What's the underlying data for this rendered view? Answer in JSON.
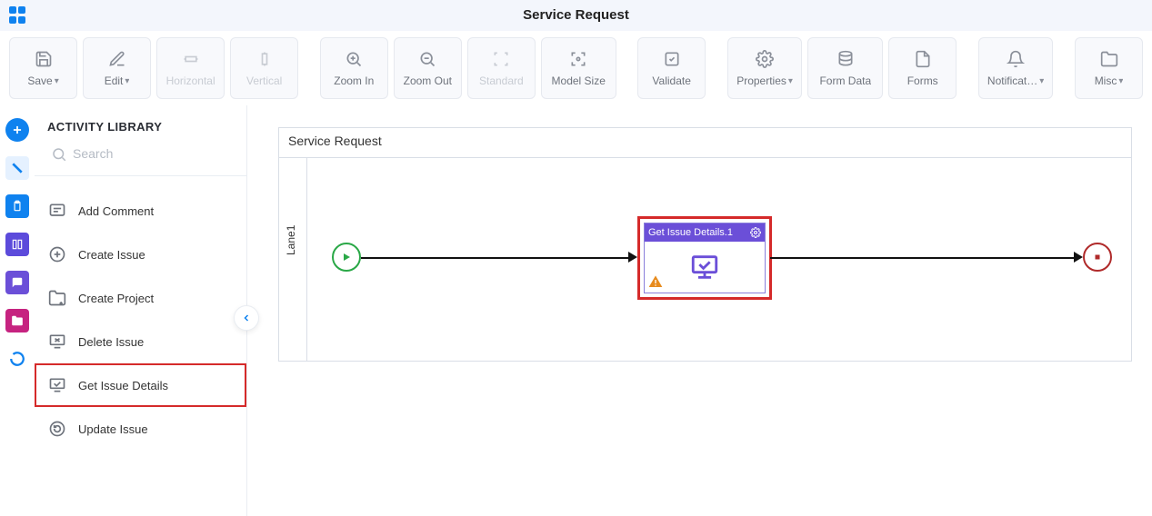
{
  "page": {
    "title": "Service Request"
  },
  "toolbar": {
    "save": "Save",
    "edit": "Edit",
    "horizontal": "Horizontal",
    "vertical": "Vertical",
    "zoom_in": "Zoom In",
    "zoom_out": "Zoom Out",
    "standard": "Standard",
    "model_size": "Model Size",
    "validate": "Validate",
    "properties": "Properties",
    "form_data": "Form Data",
    "forms": "Forms",
    "notifications": "Notificat…",
    "misc": "Misc"
  },
  "sidebar": {
    "title": "ACTIVITY LIBRARY",
    "search_placeholder": "Search",
    "items": {
      "add_comment": "Add Comment",
      "create_issue": "Create Issue",
      "create_project": "Create Project",
      "delete_issue": "Delete Issue",
      "get_issue_details": "Get Issue Details",
      "update_issue": "Update Issue"
    }
  },
  "canvas": {
    "title": "Service Request",
    "lane": "Lane1",
    "activity": {
      "label": "Get Issue Details.1"
    }
  }
}
